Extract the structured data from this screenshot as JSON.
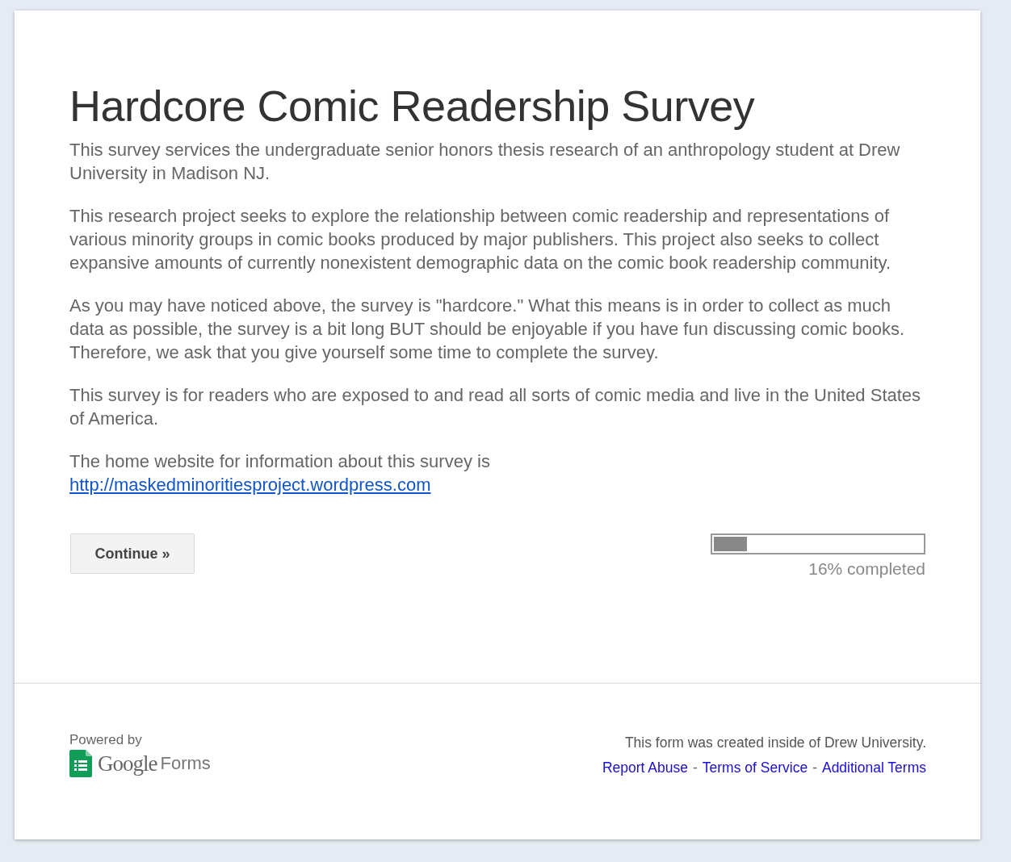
{
  "title": "Hardcore Comic Readership Survey",
  "paragraphs": [
    {
      "text": "This survey services the undergraduate senior honors thesis research of an anthropology student at Drew University in Madison NJ."
    },
    {
      "text": "This research project seeks to explore the relationship between comic readership and representations of various minority groups in comic books produced by major publishers. This project also seeks to collect expansive amounts of currently nonexistent demographic data on the comic book readership community."
    },
    {
      "text": "As you may have noticed above, the survey is \"hardcore.\" What this means is in order to collect as much data as possible, the survey is a bit long BUT should be enjoyable if you have fun discussing comic books. Therefore, we ask that you give yourself some time to complete the survey."
    },
    {
      "text": "This survey is for readers who are exposed to and read all sorts of comic media and live in the United States of America."
    },
    {
      "text": "The home website for information about this survey is",
      "link": "http://maskedminoritiesproject.wordpress.com"
    }
  ],
  "continue_button": "Continue »",
  "progress": {
    "level": 0.16,
    "label": "16% completed"
  },
  "footer": {
    "powered_by": "Powered by",
    "brand": "Google",
    "product": "Forms",
    "note": "This form was created inside of Drew University.",
    "links": [
      {
        "label": "Report Abuse"
      },
      {
        "label": "Terms of Service"
      },
      {
        "label": "Additional Terms"
      }
    ],
    "separator": "-"
  }
}
